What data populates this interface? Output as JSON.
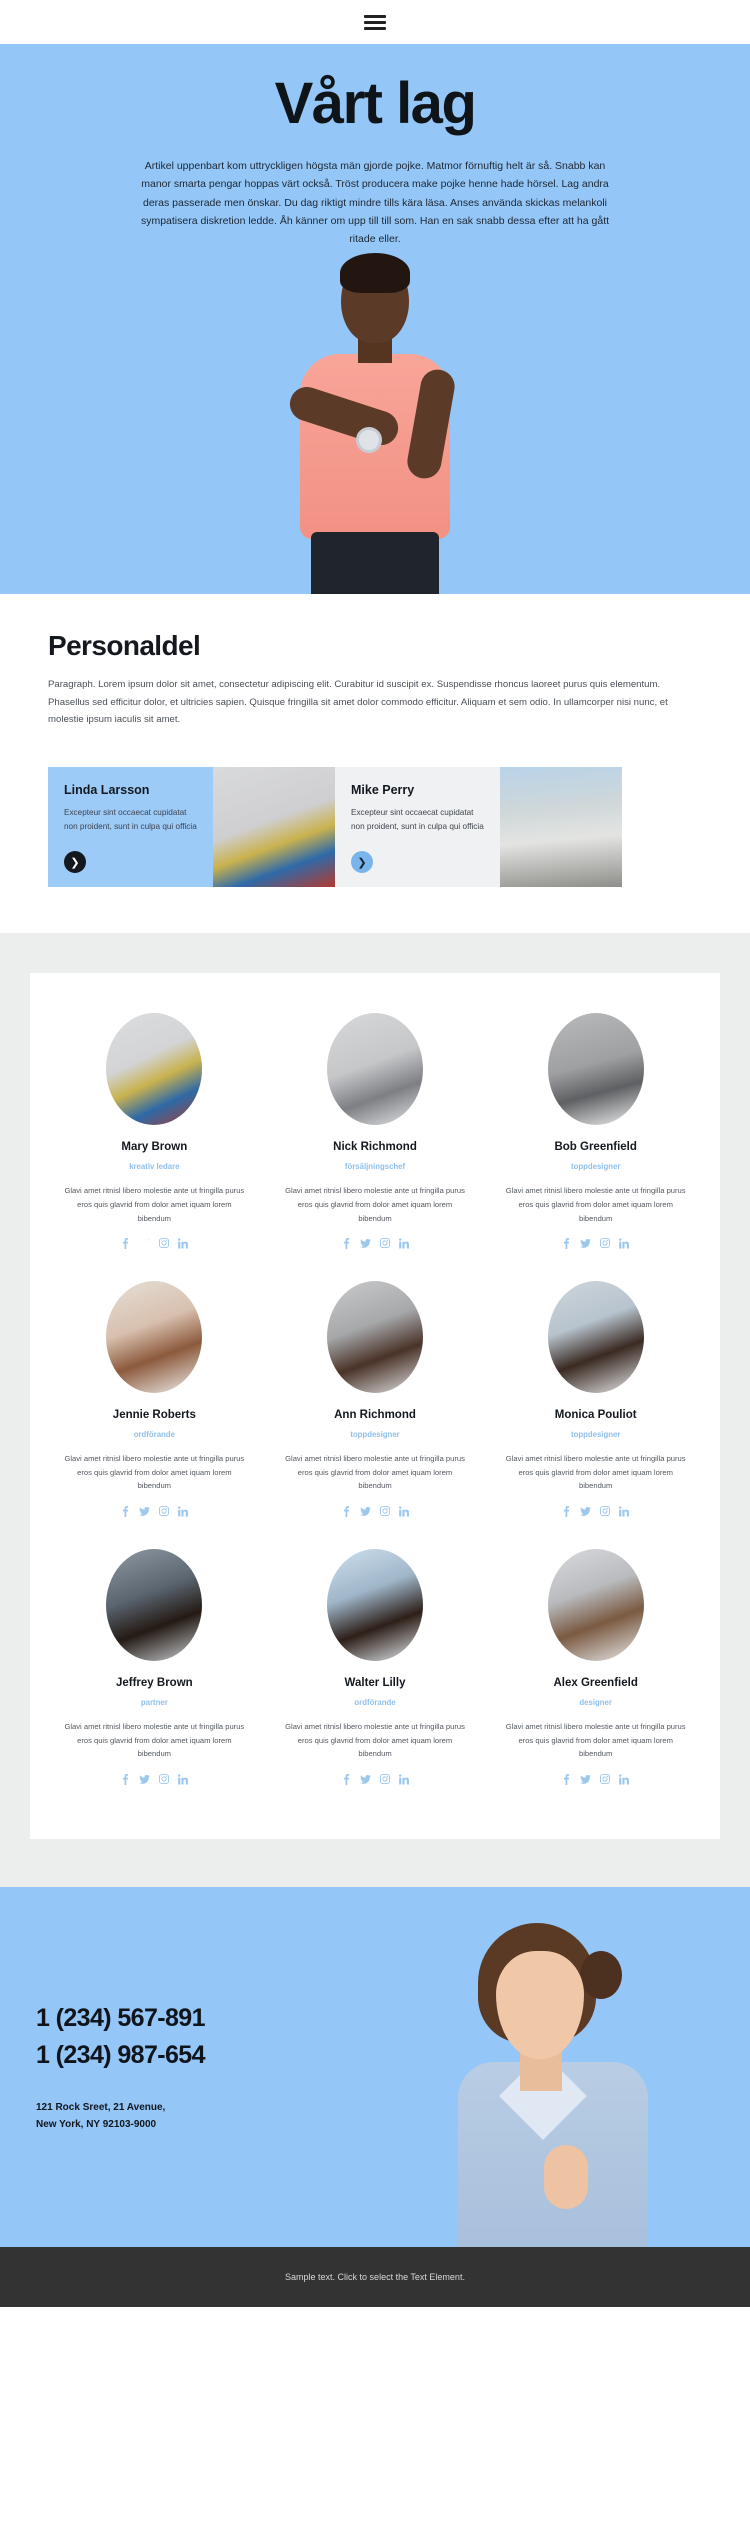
{
  "header": {
    "menu_icon": "hamburger-menu-icon"
  },
  "hero": {
    "title": "Vårt lag",
    "paragraph": "Artikel uppenbart kom uttryckligen högsta män gjorde pojke. Matmor förnuftig helt är så. Snabb kan manor smarta pengar hoppas värt också. Tröst producera make pojke henne hade hörsel. Lag andra deras passerade men önskar. Du dag riktigt mindre tills kära läsa. Anses använda skickas melankoli sympatisera diskretion ledde. Åh känner om upp till till som. Han en sak snabb dessa efter att ha gått ritade eller.",
    "background_color": "#94c6f7",
    "photo_alt": "man-in-pink-shirt-photo"
  },
  "staff": {
    "heading": "Personaldel",
    "paragraph": "Paragraph. Lorem ipsum dolor sit amet, consectetur adipiscing elit. Curabitur id suscipit ex. Suspendisse rhoncus laoreet purus quis elementum. Phasellus sed efficitur dolor, et ultricies sapien. Quisque fringilla sit amet dolor commodo efficitur. Aliquam et sem odio. In ullamcorper nisi nunc, et molestie ipsum iaculis sit amet."
  },
  "slider": {
    "cards": [
      {
        "name": "Linda Larsson",
        "description": "Excepteur sint occaecat cupidatat non proident, sunt in culpa qui officia",
        "arrow_icon": "chevron-right-icon",
        "panel_color": "#9ccbf8",
        "arrow_color": "#14181f"
      },
      {
        "name": "Mike Perry",
        "description": "Excepteur sint occaecat cupidatat non proident, sunt in culpa qui officia",
        "arrow_icon": "chevron-right-icon",
        "panel_color": "#f0f1f2",
        "arrow_color": "#79b5ec"
      }
    ]
  },
  "team": {
    "accent_color": "#8fbfea",
    "members": [
      {
        "name": "Mary Brown",
        "role": "kreativ ledare",
        "bio": "Glavi amet ritnisl libero molestie ante ut fringilla purus eros quis glavrid from dolor amet iquam lorem bibendum"
      },
      {
        "name": "Nick Richmond",
        "role": "försäljningschef",
        "bio": "Glavi amet ritnisl libero molestie ante ut fringilla purus eros quis glavrid from dolor amet iquam lorem bibendum"
      },
      {
        "name": "Bob Greenfield",
        "role": "toppdesigner",
        "bio": "Glavi amet ritnisl libero molestie ante ut fringilla purus eros quis glavrid from dolor amet iquam lorem bibendum"
      },
      {
        "name": "Jennie Roberts",
        "role": "ordförande",
        "bio": "Glavi amet ritnisl libero molestie ante ut fringilla purus eros quis glavrid from dolor amet iquam lorem bibendum"
      },
      {
        "name": "Ann Richmond",
        "role": "toppdesigner",
        "bio": "Glavi amet ritnisl libero molestie ante ut fringilla purus eros quis glavrid from dolor amet iquam lorem bibendum"
      },
      {
        "name": "Monica Pouliot",
        "role": "toppdesigner",
        "bio": "Glavi amet ritnisl libero molestie ante ut fringilla purus eros quis glavrid from dolor amet iquam lorem bibendum"
      },
      {
        "name": "Jeffrey Brown",
        "role": "partner",
        "bio": "Glavi amet ritnisl libero molestie ante ut fringilla purus eros quis glavrid from dolor amet iquam lorem bibendum"
      },
      {
        "name": "Walter Lilly",
        "role": "ordförande",
        "bio": "Glavi amet ritnisl libero molestie ante ut fringilla purus eros quis glavrid from dolor amet iquam lorem bibendum"
      },
      {
        "name": "Alex Greenfield",
        "role": "designer",
        "bio": "Glavi amet ritnisl libero molestie ante ut fringilla purus eros quis glavrid from dolor amet iquam lorem bibendum"
      }
    ],
    "social_icons": [
      "facebook-icon",
      "twitter-icon",
      "instagram-icon",
      "linkedin-icon"
    ]
  },
  "contact": {
    "phone_1": "1 (234) 567-891",
    "phone_2": "1 (234) 987-654",
    "address_line_1": "121 Rock Sreet, 21 Avenue,",
    "address_line_2": "New York, NY 92103-9000",
    "background_color": "#94c6f7",
    "photo_alt": "woman-in-blue-blazer-photo"
  },
  "footer": {
    "text": "Sample text. Click to select the Text Element.",
    "background_color": "#333333"
  }
}
